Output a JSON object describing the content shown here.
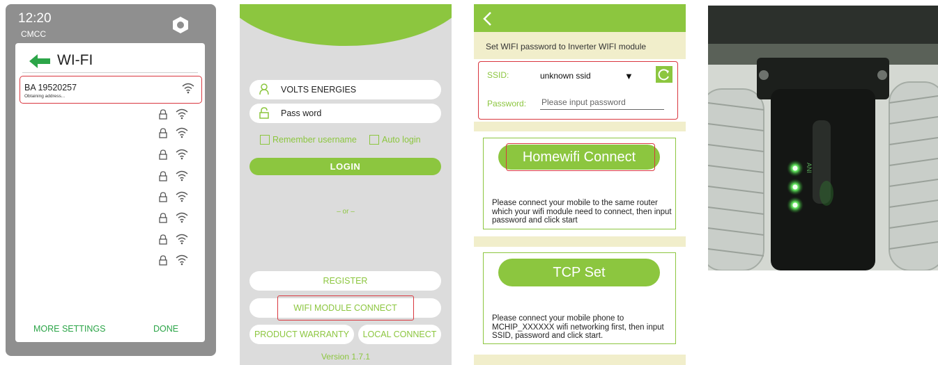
{
  "wifi_screen": {
    "clock": "12:20",
    "carrier": "CMCC",
    "title": "WI-FI",
    "selected_network": {
      "ssid": "BA 19520257",
      "status": "Obtaining address..."
    },
    "other_network_count": 8,
    "more_settings_label": "MORE SETTINGS",
    "done_label": "DONE",
    "accent_color": "#2ca548",
    "icons": [
      "hexagon-icon",
      "back-arrow-icon",
      "wifi-icon",
      "lock-icon"
    ]
  },
  "login_screen": {
    "username_value": "VOLTS ENERGIES",
    "password_value": "Pass word",
    "remember_label": "Remember username",
    "autologin_label": "Auto login",
    "login_label": "LOGIN",
    "or_label": "– or –",
    "register_label": "REGISTER",
    "wifi_module_label": "WIFI MODULE CONNECT",
    "warranty_label": "PRODUCT WARRANTY",
    "local_connect_label": "LOCAL CONNECT",
    "version": "Version 1.7.1",
    "accent_color": "#8cc63f",
    "icons": [
      "user-icon",
      "lock-icon"
    ]
  },
  "settings_screen": {
    "instruction": "Set WIFI password to Inverter WIFI module",
    "ssid_label": "SSID:",
    "ssid_value": "unknown ssid",
    "dropdown_caret": "▼",
    "password_label": "Password:",
    "password_placeholder": "Please input password",
    "homewifi_label": "Homewifi Connect",
    "homewifi_desc": "Please connect your mobile to the same router which your wifi module need to connect, then input password and click start",
    "tcp_label": "TCP Set",
    "tcp_desc": "Please connect your mobile phone to MCHIP_XXXXXX wifi networking first, then input SSID, password and click start.",
    "icons": [
      "back-chevron-icon",
      "refresh-icon"
    ]
  },
  "photo": {
    "device_text": "ANI"
  }
}
